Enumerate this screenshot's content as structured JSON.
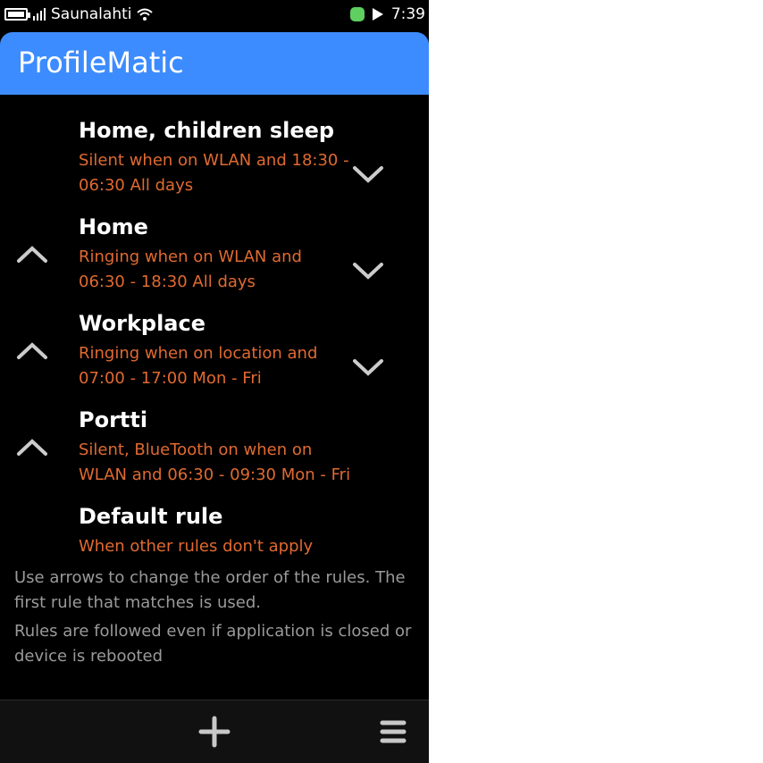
{
  "status_bar": {
    "carrier": "Saunalahti",
    "time": "7:39",
    "icons": [
      "battery-icon",
      "signal-bars-icon",
      "wifi-icon",
      "green-status-icon",
      "notification-icon"
    ]
  },
  "header": {
    "title": "ProfileMatic",
    "color": "#3d8cff"
  },
  "rules": [
    {
      "name": "Home, children sleep",
      "description": "Silent when on WLAN and 18:30 - 06:30 All days"
    },
    {
      "name": "Home",
      "description": "Ringing when on WLAN and 06:30 - 18:30 All days"
    },
    {
      "name": "Workplace",
      "description": "Ringing when on location and 07:00 - 17:00 Mon - Fri"
    },
    {
      "name": "Portti",
      "description": "Silent, BlueTooth on when on WLAN and 06:30 - 09:30 Mon - Fri"
    },
    {
      "name": "Default rule",
      "description": "When other rules don't apply"
    }
  ],
  "help": {
    "line1": "Use arrows to change the order of the rules. The first rule that matches is used.",
    "line2": "Rules are followed even if application is closed or device is rebooted"
  },
  "toolbar": {
    "icons": [
      "add-icon",
      "menu-icon"
    ]
  },
  "colors": {
    "description": "#e06a30",
    "help_text": "#9a9a9a",
    "background": "#000000"
  }
}
